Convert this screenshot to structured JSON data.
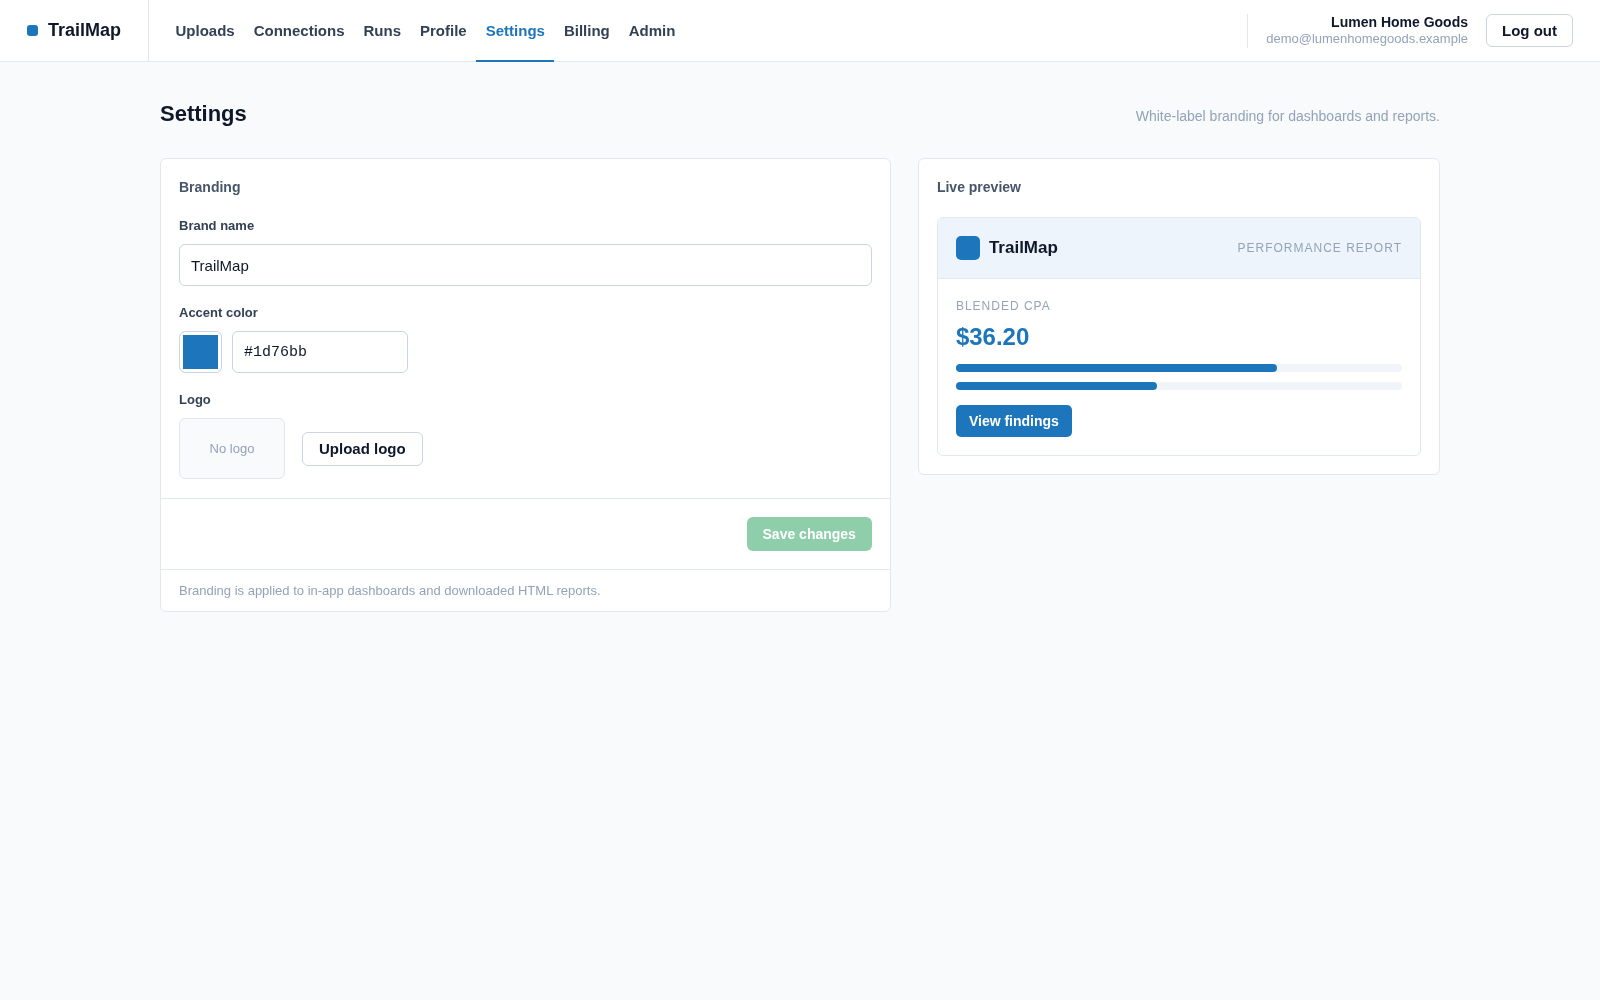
{
  "header": {
    "brand": "TrailMap",
    "nav": [
      {
        "label": "Uploads",
        "selected": false
      },
      {
        "label": "Connections",
        "selected": false
      },
      {
        "label": "Runs",
        "selected": false
      },
      {
        "label": "Profile",
        "selected": false
      },
      {
        "label": "Settings",
        "selected": true
      },
      {
        "label": "Billing",
        "selected": false
      },
      {
        "label": "Admin",
        "selected": false
      }
    ],
    "user": {
      "name": "Lumen Home Goods",
      "email": "demo@lumenhomegoods.example"
    },
    "logout_button": "Log out"
  },
  "page": {
    "title": "Settings",
    "subtitle": "White-label branding for dashboards and reports."
  },
  "branding_card": {
    "title": "Branding",
    "brand_name": {
      "label": "Brand name",
      "value": "TrailMap"
    },
    "accent_color": {
      "label": "Accent color",
      "value": "#1d76bb",
      "color": "#1d76bb"
    },
    "logo": {
      "label": "Logo",
      "empty_label": "No logo",
      "upload_button": "Upload logo"
    },
    "save_button": {
      "label": "Save changes",
      "disabled": true
    },
    "footnote": "Branding is applied to in-app dashboards and downloaded HTML reports."
  },
  "preview_card": {
    "title": "Live preview",
    "brand": "TrailMap",
    "report_label": "PERFORMANCE REPORT",
    "metric_label": "BLENDED CPA",
    "metric_value": "$36.20",
    "bars": [
      {
        "level": 0.72
      },
      {
        "level": 0.45
      }
    ],
    "button": "View findings"
  }
}
